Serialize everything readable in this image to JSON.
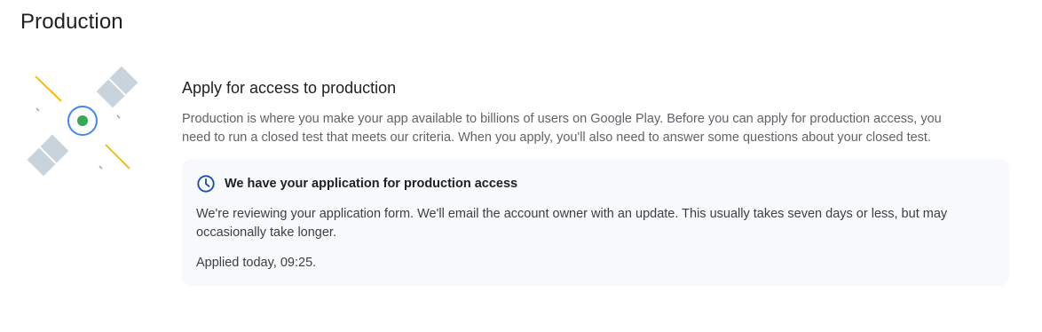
{
  "page": {
    "title": "Production"
  },
  "illustration": {
    "icon": "satellite-icon",
    "colors": {
      "panel": "#c9d3db",
      "ring": "#4285f4",
      "core": "#34a853",
      "beam": "#fbbc04",
      "spark": "#9aa0a6"
    }
  },
  "production": {
    "heading": "Apply for access to production",
    "description": "Production is where you make your app available to billions of users on Google Play. Before you can apply for production access, you need to run a closed test that meets our criteria. When you apply, you'll also need to answer some questions about your closed test."
  },
  "status_card": {
    "icon": "clock-icon",
    "icon_color": "#174ea6",
    "title": "We have your application for production access",
    "body": "We're reviewing your application form. We'll email the account owner with an update. This usually takes seven days or less, but may occasionally take longer.",
    "applied": "Applied today, 09:25."
  }
}
